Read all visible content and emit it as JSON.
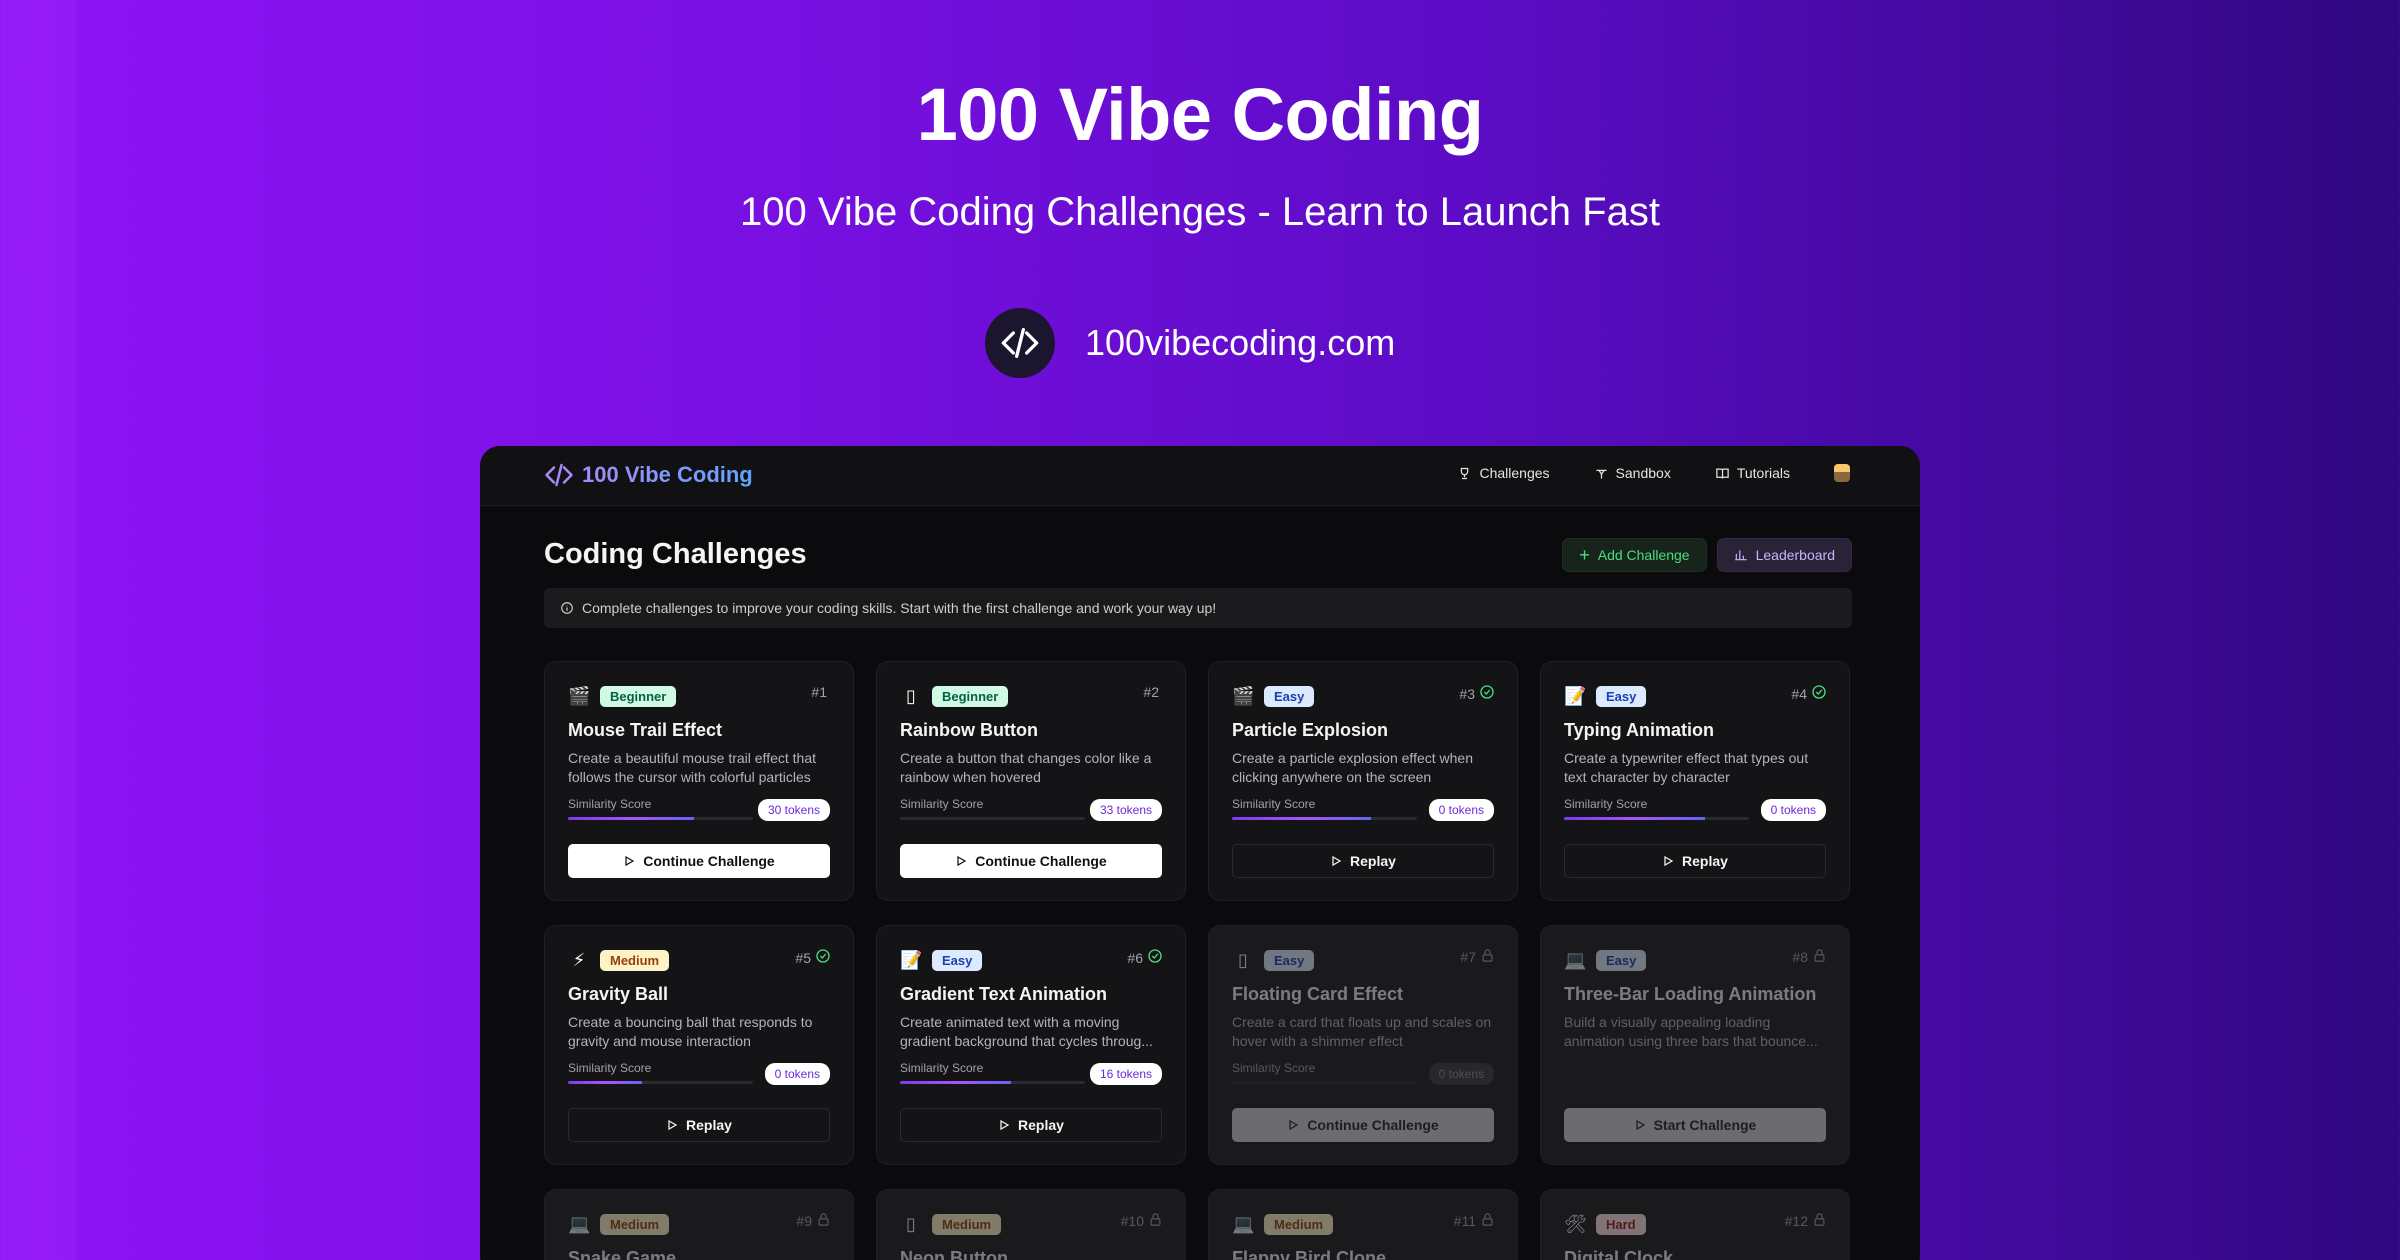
{
  "hero": {
    "title": "100 Vibe Coding",
    "subtitle": "100 Vibe Coding Challenges - Learn to Launch Fast",
    "domain": "100vibecoding.com"
  },
  "app": {
    "brand": "100 Vibe Coding",
    "nav": [
      {
        "label": "Challenges",
        "icon": "trophy-icon"
      },
      {
        "label": "Sandbox",
        "icon": "sandbox-icon"
      },
      {
        "label": "Tutorials",
        "icon": "book-icon"
      }
    ],
    "page_title": "Coding Challenges",
    "add_label": "Add Challenge",
    "leaderboard_label": "Leaderboard",
    "info": "Complete challenges to improve your coding skills. Start with the first challenge and work your way up!",
    "score_label": "Similarity Score",
    "colors": {
      "accent": "#a855f7",
      "success": "#4ade80"
    }
  },
  "cards": [
    {
      "emoji": "🎬",
      "level": "Beginner",
      "num": "#1",
      "done": false,
      "locked": false,
      "title": "Mouse Trail Effect",
      "desc": "Create a beautiful mouse trail effect that follows the cursor with colorful particles",
      "tokens": "30 tokens",
      "progress": 0.68,
      "cta": "Continue Challenge",
      "cta_style": "white"
    },
    {
      "emoji": "▯",
      "level": "Beginner",
      "num": "#2",
      "done": false,
      "locked": false,
      "title": "Rainbow Button",
      "desc": "Create a button that changes color like a rainbow when hovered",
      "tokens": "33 tokens",
      "progress": 0.0,
      "cta": "Continue Challenge",
      "cta_style": "white"
    },
    {
      "emoji": "🎬",
      "level": "Easy",
      "num": "#3",
      "done": true,
      "locked": false,
      "title": "Particle Explosion",
      "desc": "Create a particle explosion effect when clicking anywhere on the screen",
      "tokens": "0 tokens",
      "progress": 0.75,
      "cta": "Replay",
      "cta_style": "dark"
    },
    {
      "emoji": "📝",
      "level": "Easy",
      "num": "#4",
      "done": true,
      "locked": false,
      "title": "Typing Animation",
      "desc": "Create a typewriter effect that types out text character by character",
      "tokens": "0 tokens",
      "progress": 0.76,
      "cta": "Replay",
      "cta_style": "dark"
    },
    {
      "emoji": "⚡",
      "level": "Medium",
      "num": "#5",
      "done": true,
      "locked": false,
      "title": "Gravity Ball",
      "desc": "Create a bouncing ball that responds to gravity and mouse interaction",
      "tokens": "0 tokens",
      "progress": 0.4,
      "cta": "Replay",
      "cta_style": "dark"
    },
    {
      "emoji": "📝",
      "level": "Easy",
      "num": "#6",
      "done": true,
      "locked": false,
      "title": "Gradient Text Animation",
      "desc": "Create animated text with a moving gradient background that cycles throug...",
      "tokens": "16 tokens",
      "progress": 0.6,
      "cta": "Replay",
      "cta_style": "dark"
    },
    {
      "emoji": "▯",
      "level": "Easy",
      "num": "#7",
      "done": false,
      "locked": true,
      "title": "Floating Card Effect",
      "desc": "Create a card that floats up and scales on hover with a shimmer effect",
      "tokens": "0 tokens",
      "progress": 0.0,
      "cta": "Continue Challenge",
      "cta_style": "grey"
    },
    {
      "emoji": "💻",
      "level": "Easy",
      "num": "#8",
      "done": false,
      "locked": true,
      "title": "Three-Bar Loading Animation",
      "desc": "Build a visually appealing loading animation using three bars that bounce...",
      "tokens": "",
      "progress": null,
      "cta": "Start Challenge",
      "cta_style": "grey"
    },
    {
      "emoji": "💻",
      "level": "Medium",
      "num": "#9",
      "done": false,
      "locked": true,
      "title": "Snake Game",
      "desc": "",
      "tokens": "",
      "progress": null,
      "cta": "",
      "cta_style": "grey"
    },
    {
      "emoji": "▯",
      "level": "Medium",
      "num": "#10",
      "done": false,
      "locked": true,
      "title": "Neon Button",
      "desc": "",
      "tokens": "",
      "progress": null,
      "cta": "",
      "cta_style": "grey"
    },
    {
      "emoji": "💻",
      "level": "Medium",
      "num": "#11",
      "done": false,
      "locked": true,
      "title": "Flappy Bird Clone",
      "desc": "",
      "tokens": "",
      "progress": null,
      "cta": "",
      "cta_style": "grey"
    },
    {
      "emoji": "🛠",
      "level": "Hard",
      "num": "#12",
      "done": false,
      "locked": true,
      "title": "Digital Clock",
      "desc": "",
      "tokens": "",
      "progress": null,
      "cta": "",
      "cta_style": "grey"
    }
  ]
}
